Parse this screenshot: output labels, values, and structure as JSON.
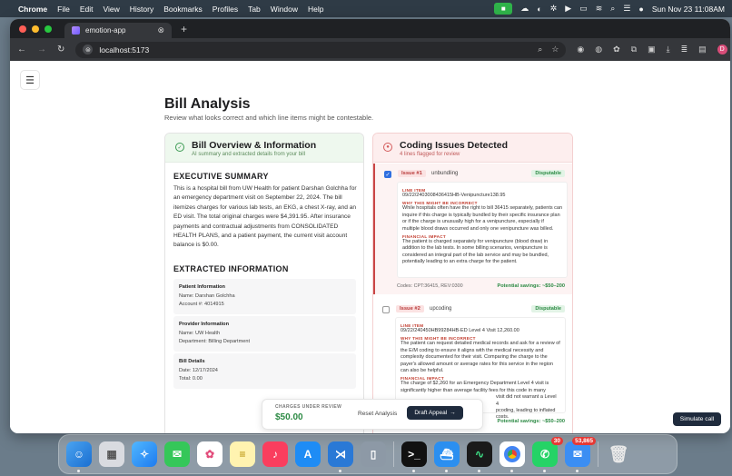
{
  "menubar": {
    "app": "Chrome",
    "items": [
      "File",
      "Edit",
      "View",
      "History",
      "Bookmarks",
      "Profiles",
      "Tab",
      "Window",
      "Help"
    ],
    "clock": "Sun Nov 23  11:08AM"
  },
  "browser": {
    "tab_title": "emotion-app",
    "url": "localhost:5173",
    "profile_initial": "D"
  },
  "page": {
    "title": "Bill Analysis",
    "subtitle": "Review what looks correct and which line items might be contestable."
  },
  "overview": {
    "title": "Bill Overview & Information",
    "subtitle": "AI summary and extracted details from your bill",
    "summary_heading": "EXECUTIVE SUMMARY",
    "summary": "This is a hospital bill from UW Health for patient Darshan Golchha for an emergency department visit on September 22, 2024. The bill itemizes charges for various lab tests, an EKG, a chest X-ray, and an ED visit. The total original charges were $4,391.95. After insurance payments and contractual adjustments from CONSOLIDATED HEALTH PLANS, and a patient payment, the current visit account balance is $0.00.",
    "extracted_heading": "EXTRACTED INFORMATION",
    "patient": {
      "heading": "Patient Information",
      "name": "Name: Darshan Golchha",
      "account": "Account #: 4014915"
    },
    "provider": {
      "heading": "Provider Information",
      "name": "Name: UW Health",
      "department": "Department: Billing Department"
    },
    "bill": {
      "heading": "Bill Details",
      "date": "Date: 12/17/2024",
      "total": "Total: 0.00"
    }
  },
  "coding": {
    "title": "Coding Issues Detected",
    "subtitle": "4 lines flagged for review",
    "labels": {
      "line_item": "LINE ITEM",
      "why": "WHY THIS MIGHT BE INCORRECT",
      "impact": "FINANCIAL IMPACT"
    },
    "issues": [
      {
        "badge": "Issue #1",
        "type": "unbundling",
        "status": "Disputable",
        "line_item": "09/22/2403008436415HB-Venipuncture138.95",
        "why": "While hospitals often have the right to bill 36415 separately, patients can inquire if this charge is typically bundled by their specific insurance plan or if the charge is unusually high for a venipuncture, especially if multiple blood draws occurred and only one venipuncture was billed.",
        "impact": "The patient is charged separately for venipuncture (blood draw) in addition to the lab tests. In some billing scenarios, venipuncture is considered an integral part of the lab service and may be bundled, potentially leading to an extra charge for the patient.",
        "codes": "Codes: CPT:36415, REV:0300",
        "savings": "Potential savings: ~$50–200"
      },
      {
        "badge": "Issue #2",
        "type": "upcoding",
        "status": "Disputable",
        "line_item": "09/22/240450HB99284HB-ED Level 4 Visit 12,260.00",
        "why": "The patient can request detailed medical records and ask for a review of the E/M coding to ensure it aligns with the medical necessity and complexity documented for their visit. Comparing the charge to the payer's allowed amount or average rates for this service in the region can also be helpful.",
        "impact": "The charge of $2,260 for an Emergency Department Level 4 visit is significantly higher than average facility fees for this code in many",
        "impact_tail_1": "visit did not warrant a Level 4",
        "impact_tail_2": "pcoding, leading to inflated costs.",
        "savings": "Potential savings: ~$50–200"
      }
    ]
  },
  "footer": {
    "charges_label": "CHARGES UNDER REVIEW",
    "amount": "$50.00",
    "reset": "Reset Analysis",
    "draft": "Draft Appeal",
    "draft_arrow": "→"
  },
  "simulate": "Simulate call",
  "dock": {
    "badges": {
      "whatsapp": "30",
      "mail": "53,865"
    }
  }
}
